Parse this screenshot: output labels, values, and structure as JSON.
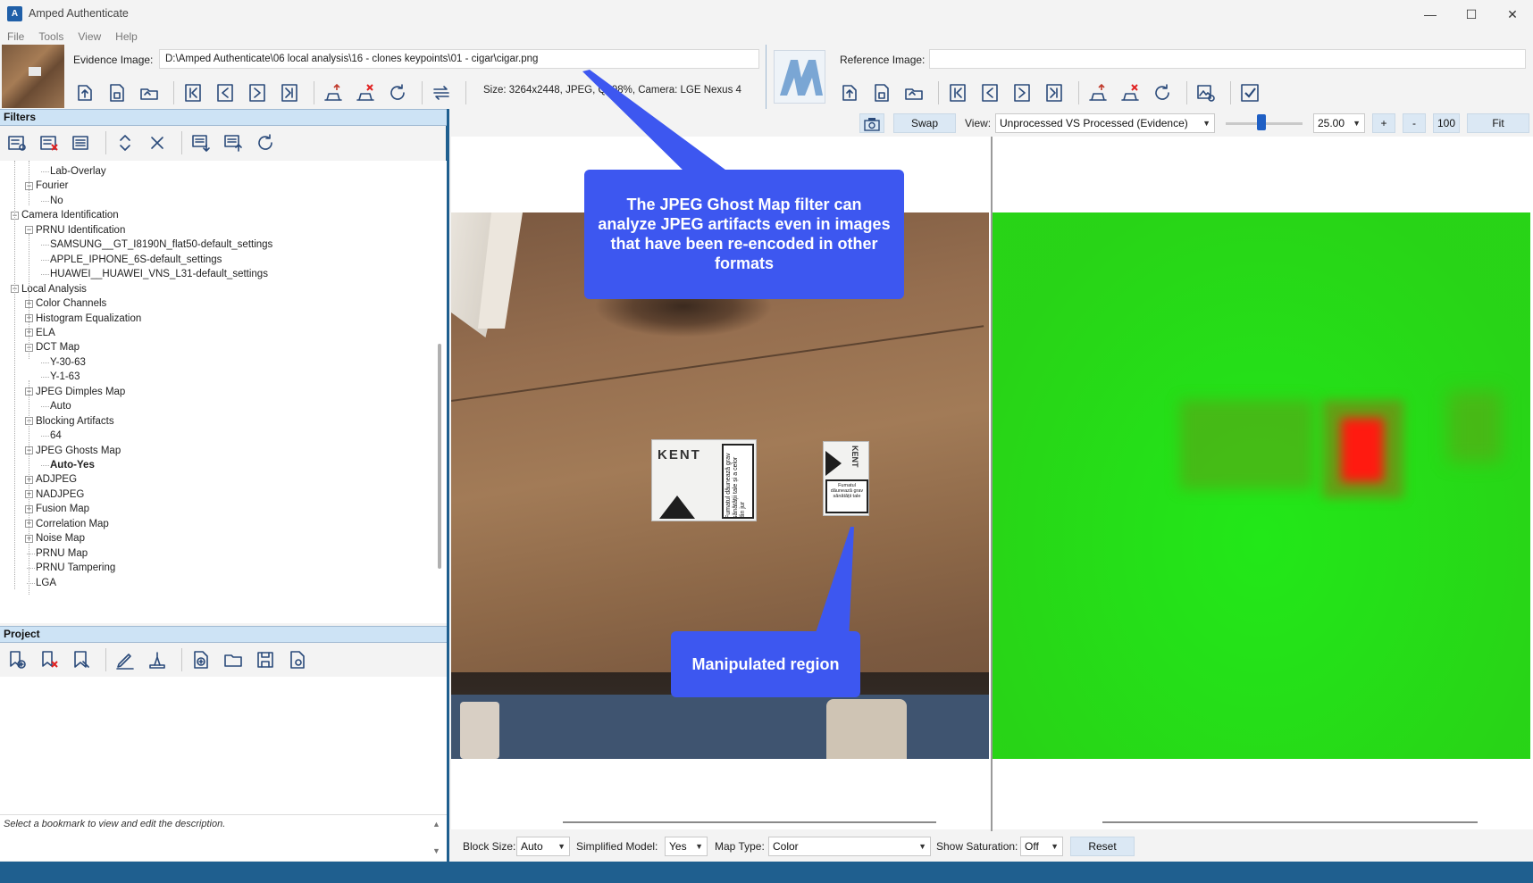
{
  "window": {
    "title": "Amped Authenticate",
    "minimize": "—",
    "maximize": "☐",
    "close": "✕"
  },
  "menu": [
    "File",
    "Tools",
    "View",
    "Help"
  ],
  "evidence": {
    "label": "Evidence Image:",
    "path": "D:\\Amped Authenticate\\06 local analysis\\16 - clones keypoints\\01 - cigar\\cigar.png",
    "info": "Size: 3264x2448, JPEG, Q: 98%, Camera: LGE Nexus 4"
  },
  "reference": {
    "label": "Reference Image:",
    "path": ""
  },
  "filters": {
    "title": "Filters",
    "tree": [
      {
        "label": "Lab-Overlay",
        "level": 2
      },
      {
        "label": "Fourier",
        "level": 1,
        "box": "−"
      },
      {
        "label": "No",
        "level": 2
      },
      {
        "label": "Camera Identification",
        "level": 0,
        "box": "−"
      },
      {
        "label": "PRNU Identification",
        "level": 1,
        "box": "−"
      },
      {
        "label": "SAMSUNG__GT_I8190N_flat50-default_settings",
        "level": 2
      },
      {
        "label": "APPLE_IPHONE_6S-default_settings",
        "level": 2
      },
      {
        "label": "HUAWEI__HUAWEI_VNS_L31-default_settings",
        "level": 2
      },
      {
        "label": "Local Analysis",
        "level": 0,
        "box": "−"
      },
      {
        "label": "Color Channels",
        "level": 1,
        "box": "+"
      },
      {
        "label": "Histogram Equalization",
        "level": 1,
        "box": "+"
      },
      {
        "label": "ELA",
        "level": 1,
        "box": "+"
      },
      {
        "label": "DCT Map",
        "level": 1,
        "box": "−"
      },
      {
        "label": "Y-30-63",
        "level": 2
      },
      {
        "label": "Y-1-63",
        "level": 2
      },
      {
        "label": "JPEG Dimples Map",
        "level": 1,
        "box": "−"
      },
      {
        "label": "Auto",
        "level": 2
      },
      {
        "label": "Blocking Artifacts",
        "level": 1,
        "box": "−"
      },
      {
        "label": "64",
        "level": 2
      },
      {
        "label": "JPEG Ghosts Map",
        "level": 1,
        "box": "−"
      },
      {
        "label": "Auto-Yes",
        "level": 2,
        "bold": true
      },
      {
        "label": "ADJPEG",
        "level": 1,
        "box": "+"
      },
      {
        "label": "NADJPEG",
        "level": 1,
        "box": "+"
      },
      {
        "label": "Fusion Map",
        "level": 1,
        "box": "+"
      },
      {
        "label": "Correlation Map",
        "level": 1,
        "box": "+"
      },
      {
        "label": "Noise Map",
        "level": 1,
        "box": "+"
      },
      {
        "label": "PRNU Map",
        "level": 1
      },
      {
        "label": "PRNU Tampering",
        "level": 1
      },
      {
        "label": "LGA",
        "level": 1
      }
    ]
  },
  "project": {
    "title": "Project",
    "hint": "Select a bookmark to view and edit the description."
  },
  "viewbar": {
    "swap": "Swap",
    "view_label": "View:",
    "view_value": "Unprocessed VS Processed (Evidence)",
    "zoom_value": "25.00",
    "plus": "+",
    "minus": "-",
    "hundred": "100",
    "fit": "Fit",
    "slider_fraction": 0.46
  },
  "callouts": {
    "top": "The JPEG Ghost Map filter can analyze JPEG artifacts even in images that have been re-encoded in other formats",
    "bottom": "Manipulated region"
  },
  "photo": {
    "pack1_brand": "KENT",
    "pack1_warning": "Fumatul dăunează grav sănătății tale și a celor din jur",
    "pack2_brand": "KENT",
    "pack2_warning": "Fumatul dăunează grav sănătății tale"
  },
  "params": {
    "block_label": "Block Size:",
    "block_value": "Auto",
    "model_label": "Simplified Model:",
    "model_value": "Yes",
    "maptype_label": "Map Type:",
    "maptype_value": "Color",
    "sat_label": "Show Saturation:",
    "sat_value": "Off",
    "reset": "Reset"
  },
  "colors": {
    "accent": "#3d57f0",
    "panel_header": "#cde3f5",
    "status": "#1f5f8f",
    "ghost_green": "#22e818",
    "ghost_red": "#ff1a10"
  },
  "icons": {
    "evidence_toolbar": [
      "import-icon",
      "import-page-icon",
      "open-folder-icon",
      "first-icon",
      "prev-icon",
      "next-icon",
      "last-icon",
      "upload-icon",
      "remove-icon",
      "refresh-icon",
      "swap-lines-icon"
    ],
    "reference_toolbar": [
      "import-icon",
      "import-page-icon",
      "open-folder-icon",
      "first-icon",
      "prev-icon",
      "next-icon",
      "last-icon",
      "upload-icon",
      "remove-icon",
      "refresh-icon",
      "image-settings-icon",
      "checkbox-icon"
    ],
    "filters_toolbar": [
      "add-filter-icon",
      "remove-filter-icon",
      "filter-list-icon",
      "collapse-icon",
      "close-all-icon",
      "export-icon",
      "upload-list-icon",
      "reset-icon"
    ],
    "project_toolbar": [
      "add-bookmark-icon",
      "remove-bookmark-icon",
      "bookmark-icon",
      "edit-icon",
      "sign-icon",
      "new-project-icon",
      "open-project-icon",
      "save-project-icon",
      "project-settings-icon"
    ]
  }
}
